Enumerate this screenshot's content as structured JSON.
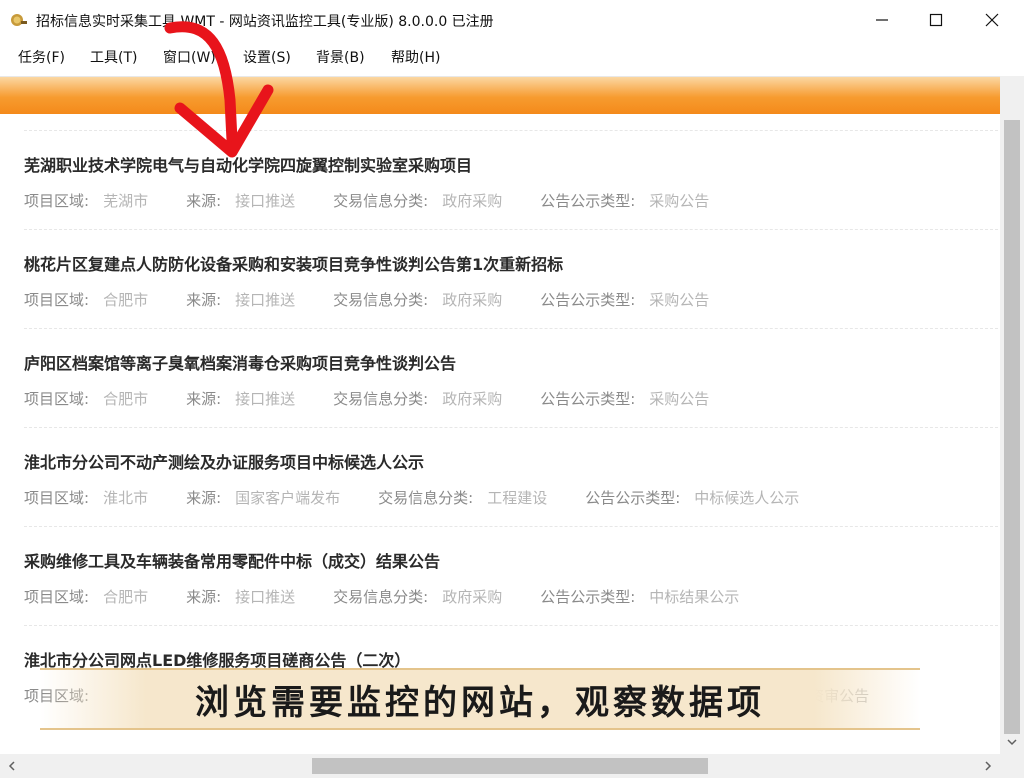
{
  "window": {
    "title": "招标信息实时采集工具 WMT  - 网站资讯监控工具(专业版) 8.0.0.0  已注册"
  },
  "menu": [
    {
      "label": "任务(F)"
    },
    {
      "label": "工具(T)"
    },
    {
      "label": "窗口(W)"
    },
    {
      "label": "设置(S)"
    },
    {
      "label": "背景(B)"
    },
    {
      "label": "帮助(H)"
    }
  ],
  "labels": {
    "region": "项目区域:",
    "source": "来源:",
    "category": "交易信息分类:",
    "notice_type": "公告公示类型:"
  },
  "items": [
    {
      "title": "芜湖职业技术学院电气与自动化学院四旋翼控制实验室采购项目",
      "region": "芜湖市",
      "source": "接口推送",
      "category": "政府采购",
      "notice_type": "采购公告"
    },
    {
      "title": "桃花片区复建点人防防化设备采购和安装项目竞争性谈判公告第1次重新招标",
      "region": "合肥市",
      "source": "接口推送",
      "category": "政府采购",
      "notice_type": "采购公告"
    },
    {
      "title": "庐阳区档案馆等离子臭氧档案消毒仓采购项目竞争性谈判公告",
      "region": "合肥市",
      "source": "接口推送",
      "category": "政府采购",
      "notice_type": "采购公告"
    },
    {
      "title": "淮北市分公司不动产测绘及办证服务项目中标候选人公示",
      "region": "淮北市",
      "source": "国家客户端发布",
      "category": "工程建设",
      "notice_type": "中标候选人公示"
    },
    {
      "title": "采购维修工具及车辆装备常用零配件中标（成交）结果公告",
      "region": "合肥市",
      "source": "接口推送",
      "category": "政府采购",
      "notice_type": "中标结果公示"
    },
    {
      "title": "淮北市分公司网点LED维修服务项目磋商公告（二次）",
      "region": "",
      "source": "",
      "category": "",
      "notice_type": "资审公告"
    }
  ],
  "caption": "浏览需要监控的网站，观察数据项",
  "colors": {
    "accent_orange": "#f48a1a",
    "annotation_red": "#e8141b",
    "caption_bg": "#f6e7cc"
  }
}
